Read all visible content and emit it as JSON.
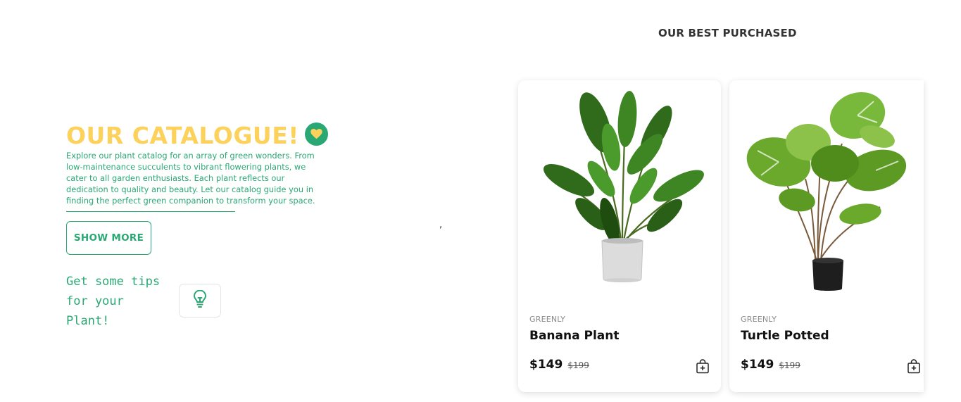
{
  "catalogue": {
    "title": "OUR CATALOGUE!",
    "description": "Explore our plant catalog for an array of green wonders. From low-maintenance succulents to vibrant flowering plants, we cater to all garden enthusiasts. Each plant reflects our dedication to quality and beauty. Let our catalog guide you in finding the perfect green companion to transform your space.",
    "show_more_label": "SHOW MORE",
    "tips_line1": "Get some tips",
    "tips_line2": "for your",
    "tips_line3": "Plant!"
  },
  "stray_char": ",",
  "best": {
    "title": "OUR BEST PURCHASED",
    "products": [
      {
        "brand": "GREENLY",
        "name": "Banana Plant",
        "price": "$149",
        "old_price": "$199"
      },
      {
        "brand": "GREENLY",
        "name": "Turtle Potted",
        "price": "$149",
        "old_price": "$199"
      }
    ]
  },
  "colors": {
    "accent_green": "#2aa874",
    "accent_yellow": "#fcd15c"
  },
  "icons": [
    "heart-icon",
    "lightbulb-icon",
    "add-to-bag-icon"
  ]
}
